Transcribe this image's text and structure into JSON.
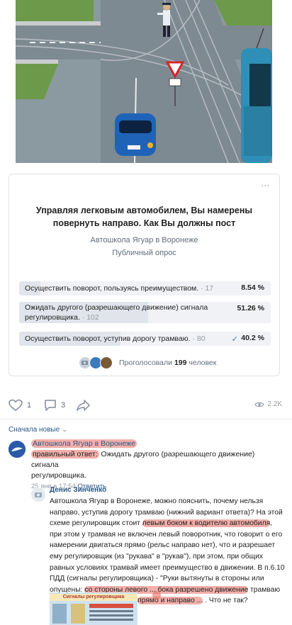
{
  "poll": {
    "more_icon": "⋯",
    "question": "Управляя легковым автомобилем, Вы намерены повернуть направо. Как Вы должны пост",
    "author": "Автошкола Ягуар в Воронеже",
    "type": "Публичный опрос",
    "options": [
      {
        "text": "Осуществить поворот, пользуясь преимуществом.",
        "count": "· 17",
        "percent": "8.54 %",
        "fraction": 0.0854,
        "selected": false
      },
      {
        "text_line1": "Ожидать другого (разрешающего движение) сигнала",
        "text_line2": "регулировщика.",
        "count": "· 102",
        "percent": "51.26 %",
        "fraction": 0.5126,
        "selected": false
      },
      {
        "text": "Осуществить поворот, уступив дорогу трамваю.",
        "count": "· 80",
        "percent": "40.2 %",
        "fraction": 0.402,
        "selected": true
      }
    ],
    "voted_prefix": "Проголосовали",
    "voted_count": "199",
    "voted_suffix": "человек"
  },
  "actions": {
    "likes": "1",
    "comments": "3",
    "views": "2.2K"
  },
  "comments": {
    "sort_label": "Сначала новые",
    "first": {
      "author": "Автошкола Ягуар в Воронеже",
      "prefix": "правильный ответ:",
      "text_rest": " Ожидать другого (разрешающего движение) сигнала",
      "text_line2": "регулировщика.",
      "date": "25 янв в 17:54",
      "reply": "Ответить"
    },
    "second": {
      "author": "Денис Зинченко",
      "p1": "Автошкола Ягуар в Воронеже, можно пояснить, почему нельзя направо, уступив дорогу трамваю (нижний вариант ответа)? На этой схеме регулировщик стоит ",
      "h1": "левым боком к водителю автомобиля",
      "p2": ", при этом у трамвая не включен левый поворотник, что говорит о его намерении двигаться прямо (рельс направо нет), что и разрешает ему регулировщик (из \"рукава\" в \"рукав\"), при этом, при общих равных условиях трамвай имеет преимущество в движении. В п.6.10 ПДД (сигналы регулировщика) - \"Руки вытянуты в стороны или опущены: ",
      "h2": "со стороны левого ... бока разрешено движение",
      "p3": " трамваю прямо, безрельсовым ТС ",
      "h3": "прямо и направо ...",
      "p4": " . Что не так? Поясните?",
      "thumb_title": "Сигналы регулировщика"
    }
  },
  "colors": {
    "link": "#2a5885",
    "highlight": "#e86e64",
    "poll_bar": "#e1e5eb"
  }
}
